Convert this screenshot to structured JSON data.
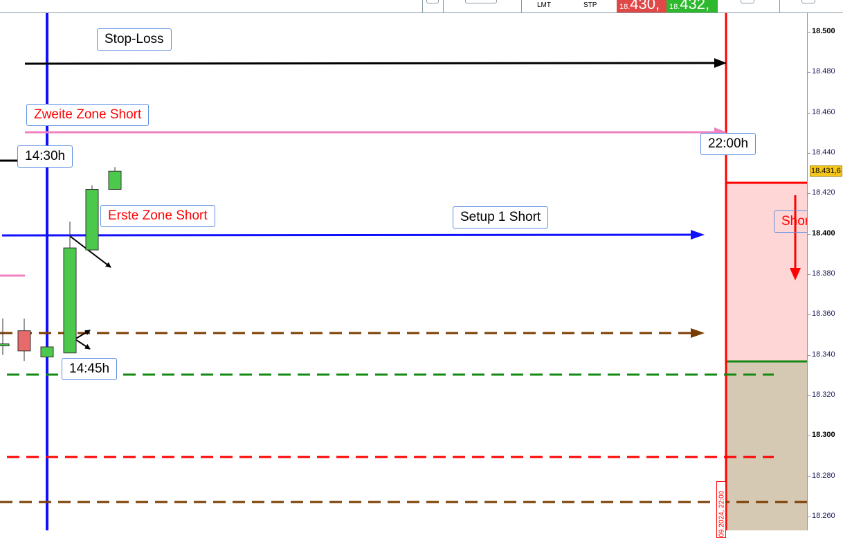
{
  "toolbar": {
    "limit_label": "LMT",
    "stop_label": "STP",
    "bid": {
      "prefix": "18.",
      "main": "430,"
    },
    "ask": {
      "prefix": "18.",
      "main": "432,"
    },
    "bid_color": "#e04848",
    "ask_color": "#2eb82e"
  },
  "labels": {
    "stop_loss": "Stop-Loss",
    "zweite_zone": "Zweite Zone Short",
    "time_1430": "14:30h",
    "time_2200": "22:00h",
    "erste_zone": "Erste Zone Short",
    "setup1": "Setup 1 Short",
    "time_1445": "14:45h",
    "short": "Short"
  },
  "axis": {
    "ticks": [
      "18.500",
      "18.480",
      "18.460",
      "18.440",
      "18.420",
      "18.400",
      "18.380",
      "18.360",
      "18.340",
      "18.320",
      "18.300",
      "18.280",
      "18.260"
    ],
    "current_price": "18.431,6"
  },
  "date_label": "09.2024, 22:00",
  "candles": [
    {
      "o": 18.3445,
      "h": 18.358,
      "l": 18.34,
      "c": 18.3455
    },
    {
      "o": 18.352,
      "h": 18.358,
      "l": 18.337,
      "c": 18.342
    },
    {
      "o": 18.339,
      "h": 18.344,
      "l": 18.339,
      "c": 18.344
    },
    {
      "o": 18.341,
      "h": 18.406,
      "l": 18.341,
      "c": 18.393
    },
    {
      "o": 18.392,
      "h": 18.424,
      "l": 18.392,
      "c": 18.422
    },
    {
      "o": 18.422,
      "h": 18.433,
      "l": 18.422,
      "c": 18.431
    }
  ]
}
